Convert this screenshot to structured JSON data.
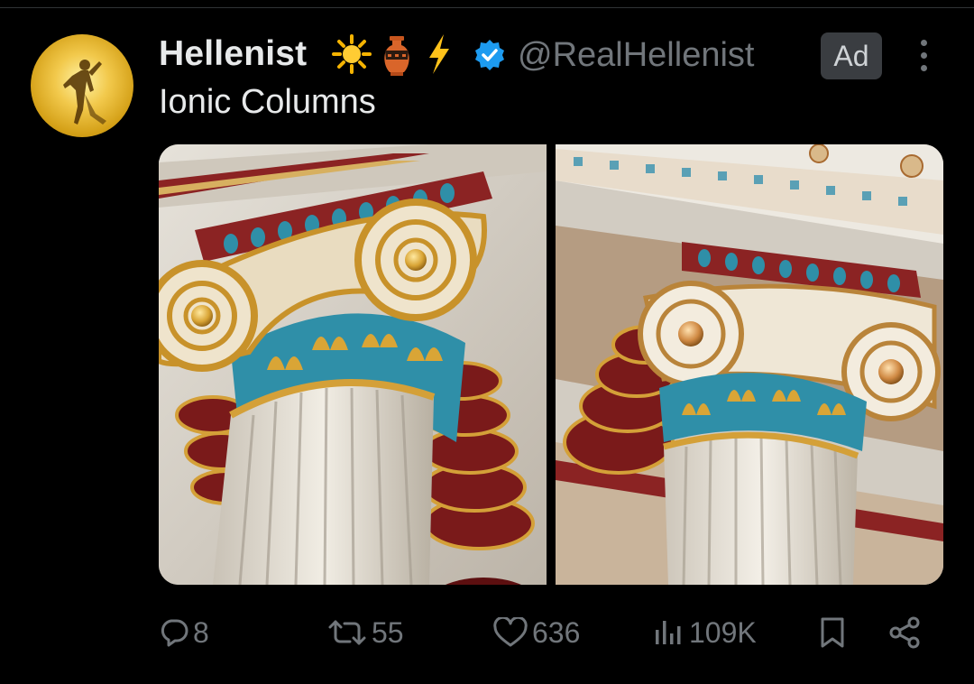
{
  "post": {
    "author": {
      "display_name": "Hellenist",
      "handle": "@RealHellenist",
      "verified": true,
      "avatar_icon": "golden-statue-avatar",
      "name_emojis": [
        "sun-icon",
        "amphora-icon",
        "lightning-icon"
      ]
    },
    "ad_label": "Ad",
    "text": "Ionic Columns",
    "media": [
      {
        "name": "ionic-capital-photo-left"
      },
      {
        "name": "ionic-capital-photo-right"
      }
    ],
    "stats": {
      "replies": "8",
      "reposts": "55",
      "likes": "636",
      "views": "109K"
    }
  },
  "colors": {
    "background": "#000000",
    "primary_text": "#e7e9ea",
    "secondary_text": "#71767b",
    "verified_blue": "#1d9bf0",
    "ad_badge": "#3a3d41"
  }
}
